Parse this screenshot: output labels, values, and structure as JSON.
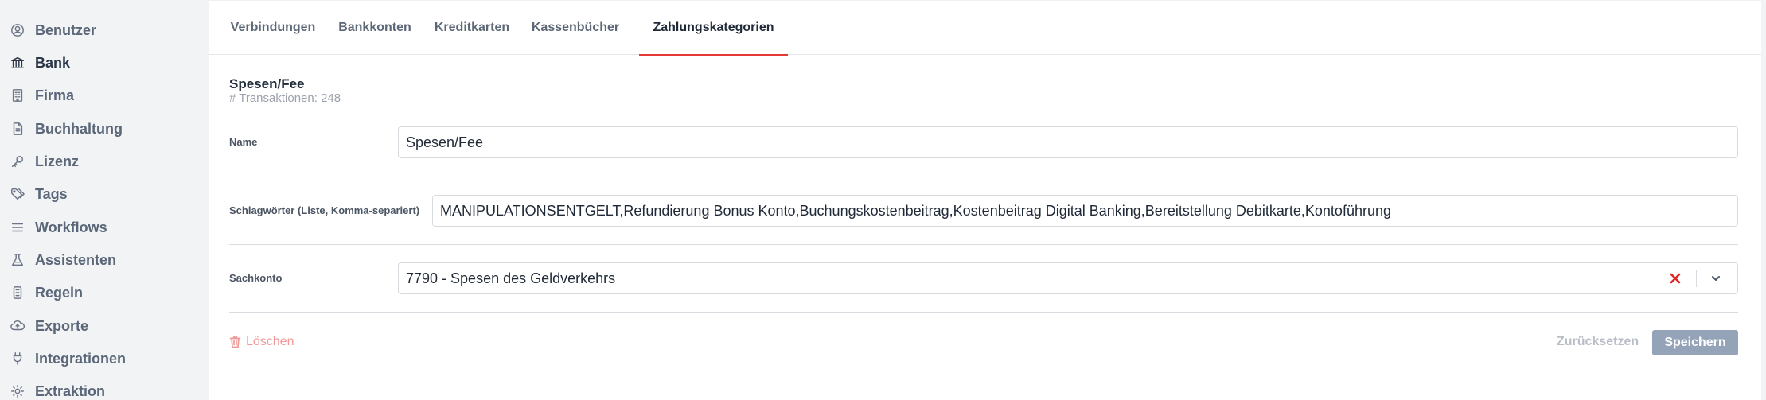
{
  "sidebar": {
    "items": [
      {
        "label": "Benutzer",
        "icon": "user-icon"
      },
      {
        "label": "Bank",
        "icon": "bank-icon",
        "active": true
      },
      {
        "label": "Firma",
        "icon": "building-icon"
      },
      {
        "label": "Buchhaltung",
        "icon": "document-icon"
      },
      {
        "label": "Lizenz",
        "icon": "key-icon"
      },
      {
        "label": "Tags",
        "icon": "tags-icon"
      },
      {
        "label": "Workflows",
        "icon": "list-icon"
      },
      {
        "label": "Assistenten",
        "icon": "flask-icon"
      },
      {
        "label": "Regeln",
        "icon": "rules-icon"
      },
      {
        "label": "Exporte",
        "icon": "cloud-upload-icon"
      },
      {
        "label": "Integrationen",
        "icon": "plug-icon"
      },
      {
        "label": "Extraktion",
        "icon": "gear-icon"
      }
    ]
  },
  "tabs": [
    {
      "label": "Verbindungen"
    },
    {
      "label": "Bankkonten"
    },
    {
      "label": "Kreditkarten"
    },
    {
      "label": "Kassenbücher"
    },
    {
      "label": "Zahlungskategorien",
      "active": true
    }
  ],
  "category": {
    "title": "Spesen/Fee",
    "transactions": "# Transaktionen: 248"
  },
  "form": {
    "name_label": "Name",
    "name_value": "Spesen/Fee",
    "keywords_label": "Schlagwörter (Liste, Komma-separiert)",
    "keywords_value": "MANIPULATIONSENTGELT,Refundierung Bonus Konto,Buchungskostenbeitrag,Kostenbeitrag Digital Banking,Bereitstellung Debitkarte,Kontoführung",
    "account_label": "Sachkonto",
    "account_value": "7790 - Spesen des Geldverkehrs"
  },
  "actions": {
    "delete_label": "Löschen",
    "reset_label": "Zurücksetzen",
    "save_label": "Speichern"
  },
  "colors": {
    "accent": "#e53935",
    "sidebar_bg": "#f1f3f5",
    "save_bg": "#94a3b8",
    "delete": "#f19999"
  }
}
